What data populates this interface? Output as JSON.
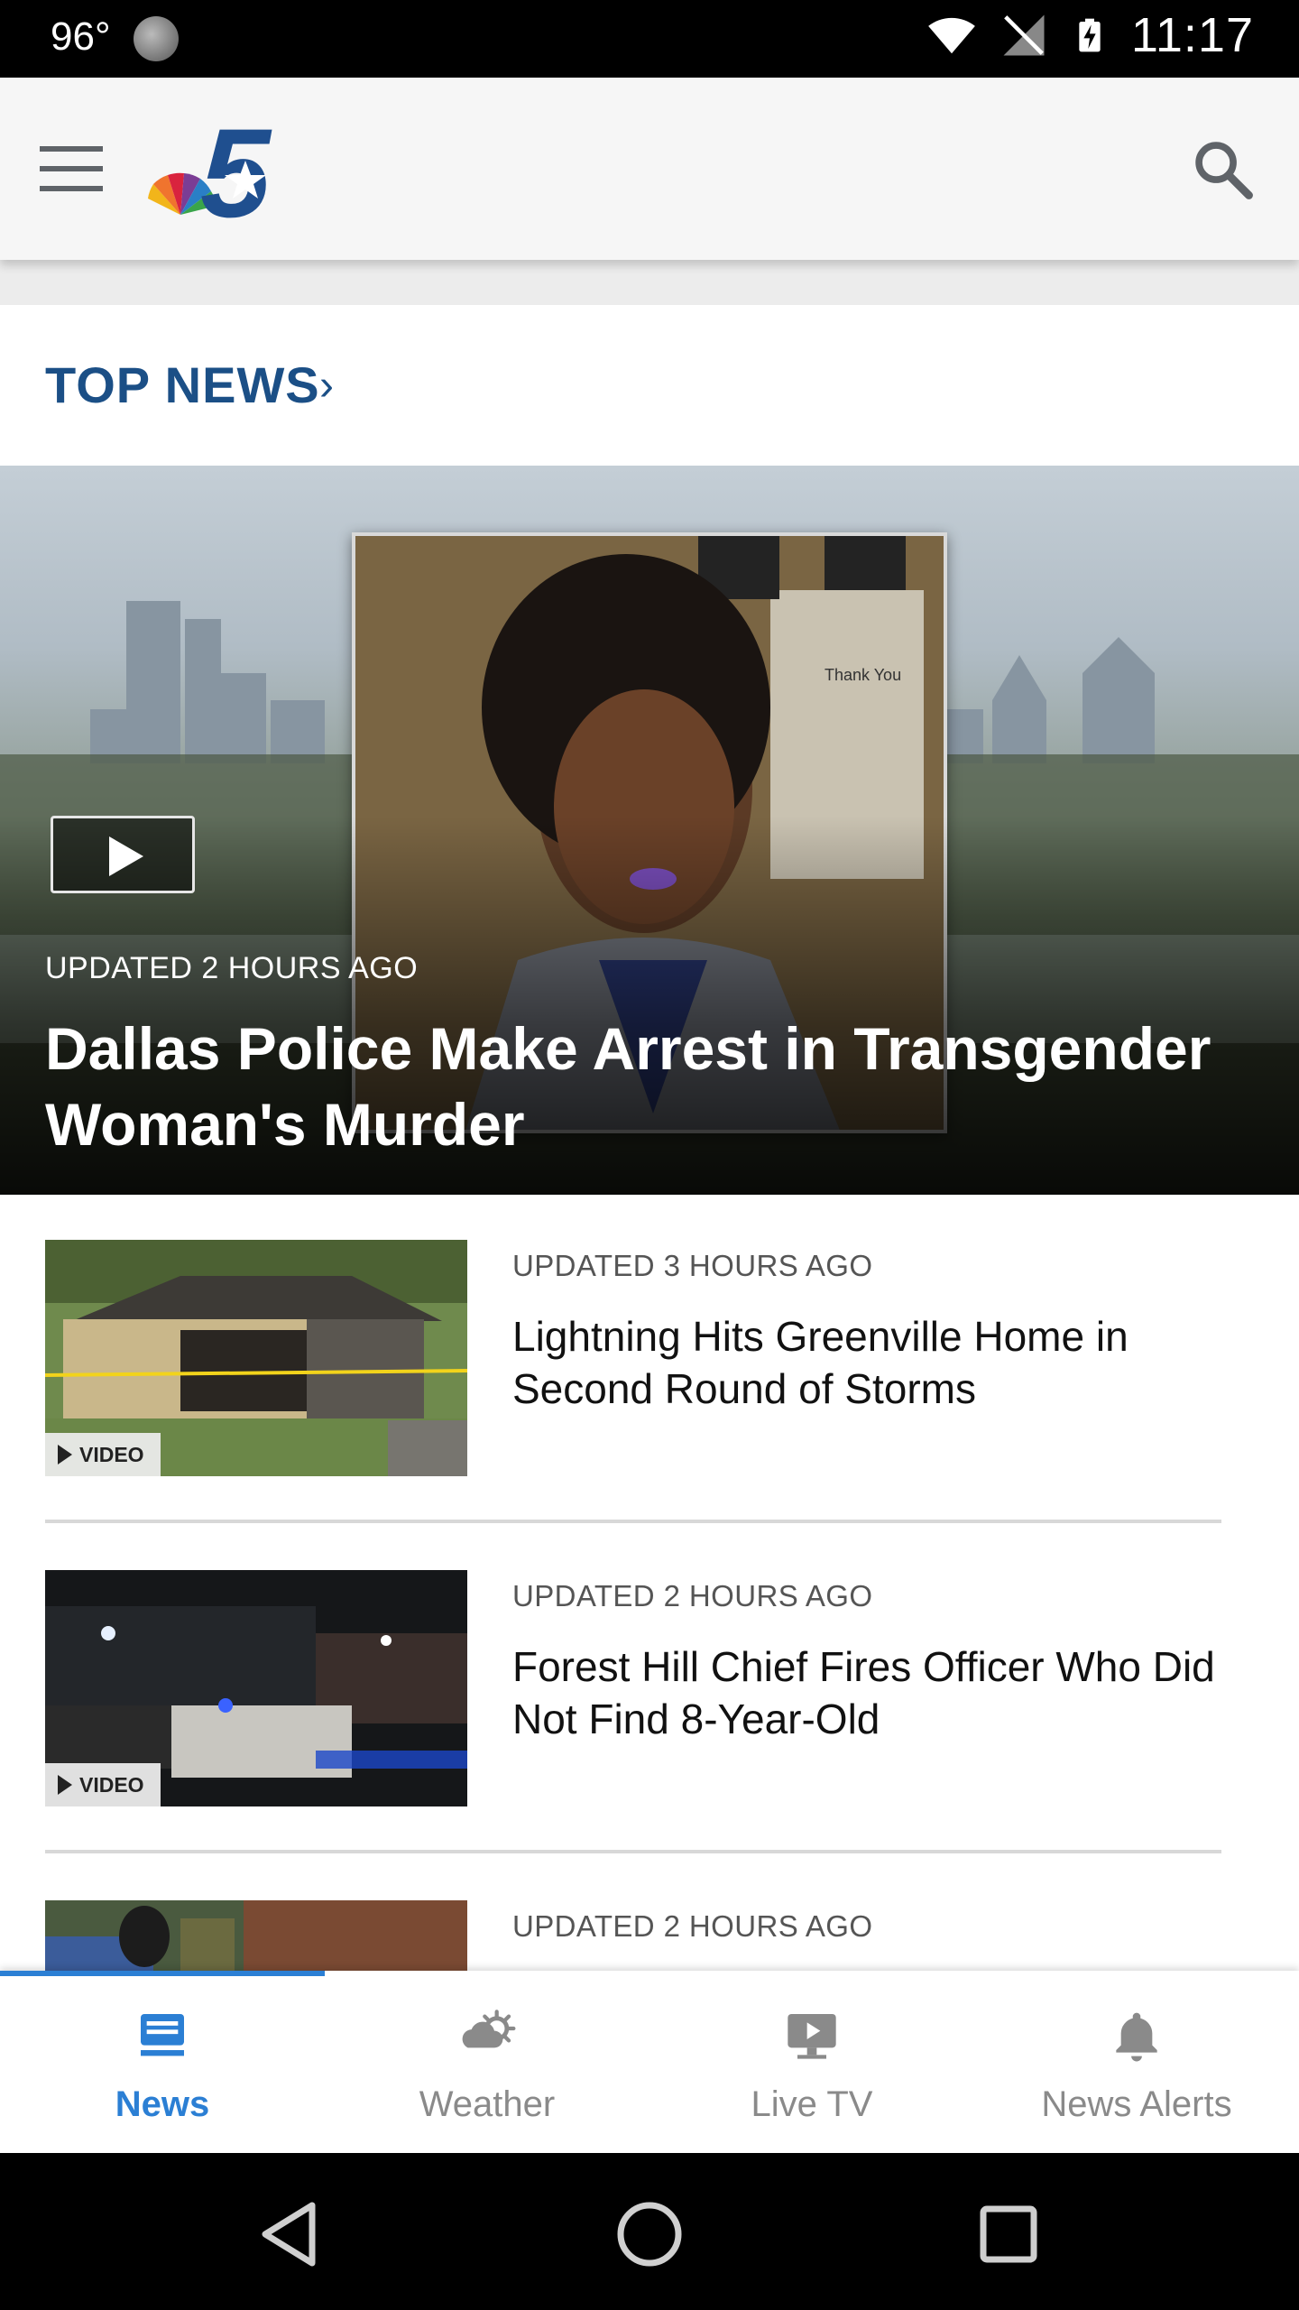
{
  "status_bar": {
    "temperature": "96°",
    "time": "11:17"
  },
  "app_bar": {
    "logo_text": "5"
  },
  "section": {
    "title": "TOP NEWS",
    "chevron": "›"
  },
  "hero": {
    "updated": "UPDATED 2 HOURS AGO",
    "title": "Dallas Police Make Arrest in Transgender Woman's Murder",
    "thumb_text": "Thank You"
  },
  "stories": [
    {
      "updated": "UPDATED 3 HOURS AGO",
      "title": "Lightning Hits Greenville Home in Second Round of Storms",
      "badge": "VIDEO"
    },
    {
      "updated": "UPDATED 2 HOURS AGO",
      "title": "Forest Hill Chief Fires Officer Who Did Not Find 8-Year-Old",
      "badge": "VIDEO"
    },
    {
      "updated": "UPDATED 2 HOURS AGO",
      "title": ""
    }
  ],
  "bottom_nav": {
    "items": [
      {
        "label": "News",
        "icon": "news-icon",
        "active": true
      },
      {
        "label": "Weather",
        "icon": "weather-icon",
        "active": false
      },
      {
        "label": "Live TV",
        "icon": "live-tv-icon",
        "active": false
      },
      {
        "label": "News Alerts",
        "icon": "bell-icon",
        "active": false
      }
    ]
  },
  "colors": {
    "accent": "#2b7fd4",
    "section_title": "#1b4f86",
    "inactive": "#8a8a8a"
  }
}
